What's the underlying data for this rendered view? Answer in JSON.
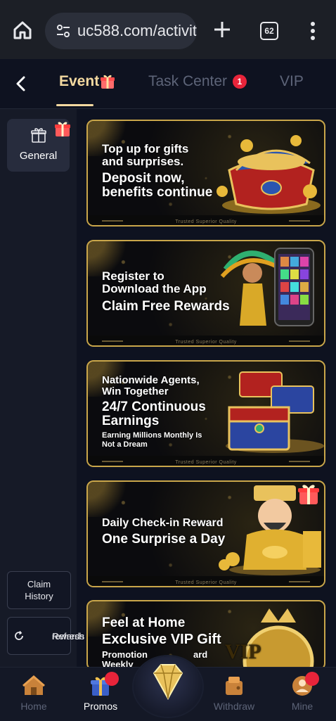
{
  "browser": {
    "url": "uc588.com/activit",
    "tab_count": "62"
  },
  "tabs": {
    "event": "Event",
    "task_center": "Task Center",
    "task_center_badge": "1",
    "vip": "VIP"
  },
  "sidebar": {
    "general": "General",
    "claim_history_line1": "Claim",
    "claim_history_line2": "History",
    "refresh_line1": "Refresh",
    "refresh_line2": "rewards"
  },
  "banners": [
    {
      "line1": "Top up for gifts",
      "line2": "and surprises.",
      "line3": "Deposit now,",
      "line4": "benefits continue",
      "tag": "Trusted Superior Quality"
    },
    {
      "line1": "Register to",
      "line2": "Download the App",
      "line3": "Claim Free Rewards",
      "tag": "Trusted Superior Quality"
    },
    {
      "line1": "Nationwide Agents,",
      "line2": "Win Together",
      "line3": "24/7 Continuous",
      "line4": "Earnings",
      "line5": "Earning Millions Monthly Is",
      "line6": "Not a Dream",
      "tag": "Trusted Superior Quality"
    },
    {
      "line1": "Daily Check-in Reward",
      "line2": "One Surprise a Day",
      "tag": "Trusted Superior Quality"
    },
    {
      "line1": "Feel at Home",
      "line2": "Exclusive VIP Gift",
      "line3": "Promotion",
      "line4": "ard",
      "line5": "Weekly",
      "art_text": "VIP"
    }
  ],
  "nav": {
    "home": "Home",
    "promos": "Promos",
    "withdraw": "Withdraw",
    "mine": "Mine"
  },
  "colors": {
    "accent_gold": "#f3d9a0",
    "banner_border": "#c9a64a",
    "badge_red": "#e8243a",
    "bg_dark": "#0e1220"
  }
}
